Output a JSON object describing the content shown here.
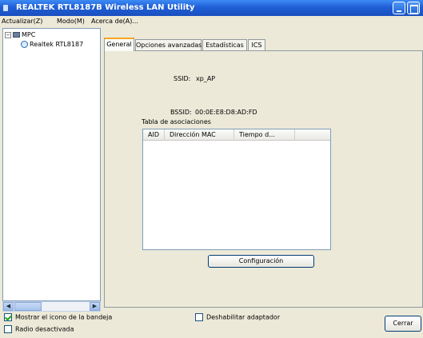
{
  "window": {
    "title": "REALTEK RTL8187B Wireless LAN Utility"
  },
  "menu": [
    "Actualizar(Z)",
    "Modo(M)",
    "Acerca de(A)..."
  ],
  "tree": {
    "root": "MPC",
    "child": "Realtek RTL8187"
  },
  "tabs": [
    "General",
    "Opciones avanzadas",
    "Estadísticas",
    "ICS"
  ],
  "general": {
    "ssid_label": "SSID:",
    "ssid_value": "xp_AP",
    "bssid_label": "BSSID:",
    "bssid_value": "00:0E:E8:D8:AD:FD",
    "assoc_title": "Tabla de asociaciones",
    "columns": [
      "AID",
      "Dirección MAC",
      "Tiempo d..."
    ],
    "config_button": "Configuración"
  },
  "footer": {
    "show_tray_icon": {
      "label": "Mostrar el icono de la bandeja",
      "checked": true
    },
    "disable_adapter": {
      "label": "Deshabilitar adaptador",
      "checked": false
    },
    "radio_off": {
      "label": "Radio desactivada",
      "checked": false
    },
    "close_button": "Cerrar"
  }
}
